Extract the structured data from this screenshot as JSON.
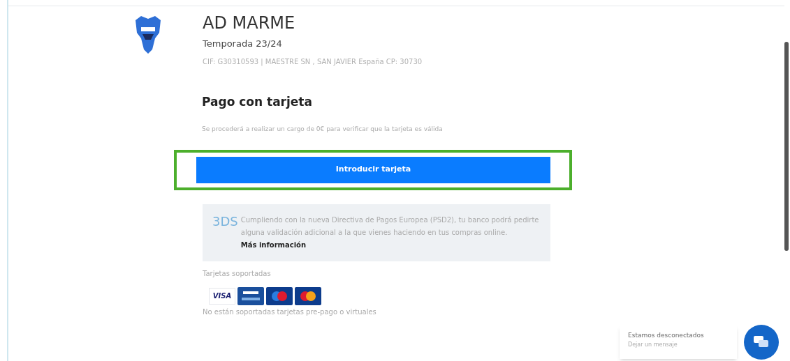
{
  "club": {
    "name": "AD MARME",
    "season": "Temporada 23/24",
    "details": "CIF: G30310593 | MAESTRE SN , SAN JAVIER España CP: 30730"
  },
  "payment": {
    "title": "Pago con tarjeta",
    "note": "Se procederá a realizar un cargo de 0€ para verificar que la tarjeta es válida",
    "button": "Introducir tarjeta",
    "highlighted": true
  },
  "info": {
    "logo": "3DS",
    "text": "Cumpliendo con la nueva Directiva de Pagos Europea (PSD2), tu banco podrá pedirte alguna validación adicional a la que vienes haciendo en tus compras online.",
    "link": "Más información"
  },
  "cards": {
    "label": "Tarjetas soportadas",
    "items": [
      {
        "kind": "visa",
        "label": "VISA"
      },
      {
        "kind": "electron"
      },
      {
        "kind": "maestro"
      },
      {
        "kind": "mastercard"
      }
    ],
    "note": "No están soportadas tarjetas pre-pago o virtuales"
  },
  "chat": {
    "status": "Estamos desconectados",
    "action": "Dejar un mensaje"
  }
}
